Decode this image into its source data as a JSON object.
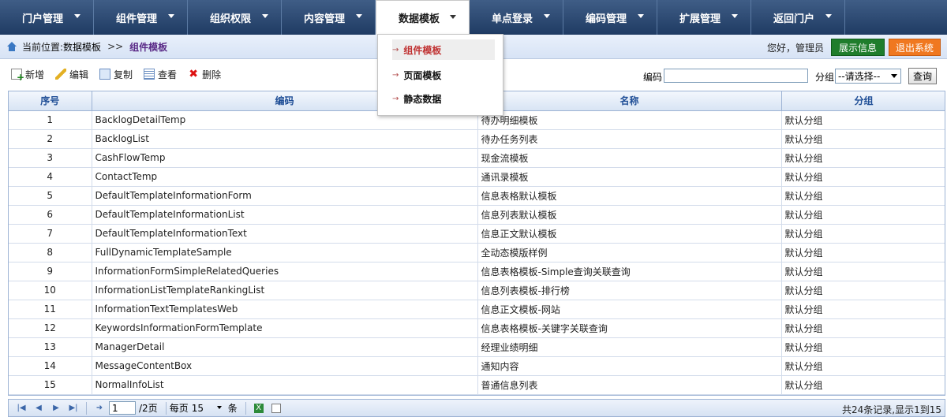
{
  "nav": {
    "items": [
      {
        "label": "门户管理"
      },
      {
        "label": "组件管理"
      },
      {
        "label": "组织权限"
      },
      {
        "label": "内容管理"
      },
      {
        "label": "数据模板"
      },
      {
        "label": "单点登录"
      },
      {
        "label": "编码管理"
      },
      {
        "label": "扩展管理"
      },
      {
        "label": "返回门户"
      }
    ],
    "dropdown": [
      "组件模板",
      "页面模板",
      "静态数据"
    ]
  },
  "breadcrumb": {
    "label": "当前位置:",
    "section": "数据模板",
    "separator": ">>",
    "current": "组件模板"
  },
  "user": {
    "greeting": "您好，管理员",
    "info_button": "展示信息",
    "exit_button": "退出系统"
  },
  "toolbar": {
    "new": "新增",
    "edit": "编辑",
    "copy": "复制",
    "view": "查看",
    "delete": "删除",
    "code_label": "编码",
    "code_value": "",
    "group_label": "分组",
    "group_selected": "--请选择--",
    "query": "查询"
  },
  "table": {
    "headers": [
      "序号",
      "编码",
      "名称",
      "分组"
    ],
    "rows": [
      [
        "1",
        "BacklogDetailTemp",
        "待办明细模板",
        "默认分组"
      ],
      [
        "2",
        "BacklogList",
        "待办任务列表",
        "默认分组"
      ],
      [
        "3",
        "CashFlowTemp",
        "现金流模板",
        "默认分组"
      ],
      [
        "4",
        "ContactTemp",
        "通讯录模板",
        "默认分组"
      ],
      [
        "5",
        "DefaultTemplateInformationForm",
        "信息表格默认模板",
        "默认分组"
      ],
      [
        "6",
        "DefaultTemplateInformationList",
        "信息列表默认模板",
        "默认分组"
      ],
      [
        "7",
        "DefaultTemplateInformationText",
        "信息正文默认模板",
        "默认分组"
      ],
      [
        "8",
        "FullDynamicTemplateSample",
        "全动态模版样例",
        "默认分组"
      ],
      [
        "9",
        "InformationFormSimpleRelatedQueries",
        "信息表格模板-Simple查询关联查询",
        "默认分组"
      ],
      [
        "10",
        "InformationListTemplateRankingList",
        "信息列表模板-排行榜",
        "默认分组"
      ],
      [
        "11",
        "InformationTextTemplatesWeb",
        "信息正文模板-网站",
        "默认分组"
      ],
      [
        "12",
        "KeywordsInformationFormTemplate",
        "信息表格模板-关键字关联查询",
        "默认分组"
      ],
      [
        "13",
        "ManagerDetail",
        "经理业绩明细",
        "默认分组"
      ],
      [
        "14",
        "MessageContentBox",
        "通知内容",
        "默认分组"
      ],
      [
        "15",
        "NormalInfoList",
        "普通信息列表",
        "默认分组"
      ]
    ]
  },
  "pager": {
    "page_value": "1",
    "page_total": "/2页",
    "per_page_label": "每页",
    "per_page_value": "15",
    "per_page_unit": "条",
    "summary": "共24条记录,显示1到15"
  },
  "colors": {
    "nav_bg": "#1f3b63",
    "info_button": "#1f7d2c",
    "exit_button": "#f07820",
    "header_text": "#1f4e96",
    "dropdown_selected": "#c03232"
  }
}
